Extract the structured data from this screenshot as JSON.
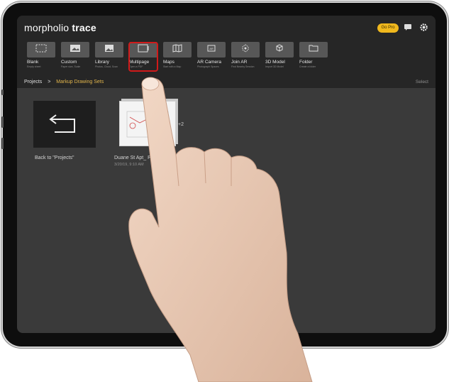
{
  "app": {
    "logo_prefix": "morpholio",
    "logo_suffix": "trace",
    "go_pro": "Go Pro"
  },
  "header_icons": [
    "chat-icon",
    "gear-icon"
  ],
  "toolbar": {
    "items": [
      {
        "label": "Blank",
        "sub": "Empty sheet",
        "icon": "blank-icon"
      },
      {
        "label": "Custom",
        "sub": "Paper size, Scale",
        "icon": "custom-icon"
      },
      {
        "label": "Library",
        "sub": "Photos, Cloud, Scan",
        "icon": "library-icon"
      },
      {
        "label": "Multipage",
        "sub": "Open a PDF",
        "icon": "multipage-icon",
        "highlighted": true
      },
      {
        "label": "Maps",
        "sub": "Start with a Map",
        "icon": "maps-icon"
      },
      {
        "label": "AR Camera",
        "sub": "Photograph Spaces",
        "icon": "ar-camera-icon"
      },
      {
        "label": "Join AR",
        "sub": "Find Nearby Session",
        "icon": "join-ar-icon"
      },
      {
        "label": "3D Model",
        "sub": "Import 3D Model",
        "icon": "3d-model-icon"
      },
      {
        "label": "Folder",
        "sub": "Create a folder",
        "icon": "folder-icon"
      }
    ]
  },
  "breadcrumb": {
    "root": "Projects",
    "separator": ">",
    "current": "Markup Drawing Sets"
  },
  "select_label": "Select",
  "back_card": {
    "label": "Back to \"Projects\""
  },
  "file_card": {
    "name": "Duane St Apt_ Pl",
    "date": "3/20/19, 9:10 AM",
    "badge": "+2"
  }
}
